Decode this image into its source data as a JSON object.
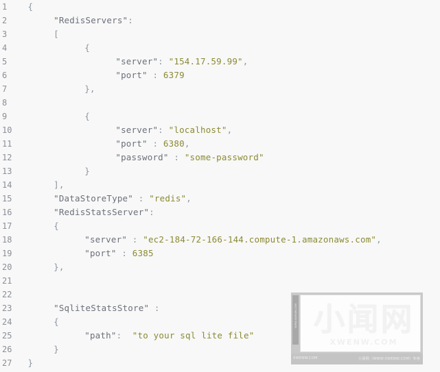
{
  "editor": {
    "language": "json",
    "background_color": "#f8f8f8",
    "gutter_color": "#8a8f98",
    "key_color": "#6b7079",
    "string_color": "#8a8a34",
    "punct_color": "#8d95a0",
    "total_lines": 27,
    "lines": [
      {
        "number": "1",
        "indent": 1,
        "tokens": [
          {
            "t": "{",
            "c": "punct"
          }
        ]
      },
      {
        "number": "2",
        "indent": 6,
        "tokens": [
          {
            "t": "\"RedisServers\"",
            "c": "key"
          },
          {
            "t": ":",
            "c": "punct"
          }
        ]
      },
      {
        "number": "3",
        "indent": 6,
        "tokens": [
          {
            "t": "[",
            "c": "punct"
          }
        ]
      },
      {
        "number": "4",
        "indent": 12,
        "tokens": [
          {
            "t": "{",
            "c": "punct"
          }
        ]
      },
      {
        "number": "5",
        "indent": 18,
        "tokens": [
          {
            "t": "\"server\"",
            "c": "key"
          },
          {
            "t": ": ",
            "c": "punct"
          },
          {
            "t": "\"154.17.59.99\"",
            "c": "str"
          },
          {
            "t": ",",
            "c": "punct"
          }
        ]
      },
      {
        "number": "6",
        "indent": 18,
        "tokens": [
          {
            "t": "\"port\"",
            "c": "key"
          },
          {
            "t": " : ",
            "c": "punct"
          },
          {
            "t": "6379",
            "c": "num"
          }
        ]
      },
      {
        "number": "7",
        "indent": 12,
        "tokens": [
          {
            "t": "}",
            "c": "punct"
          },
          {
            "t": ",",
            "c": "punct"
          }
        ]
      },
      {
        "number": "8",
        "indent": 0,
        "tokens": []
      },
      {
        "number": "9",
        "indent": 12,
        "tokens": [
          {
            "t": "{",
            "c": "punct"
          }
        ]
      },
      {
        "number": "10",
        "indent": 18,
        "tokens": [
          {
            "t": "\"server\"",
            "c": "key"
          },
          {
            "t": ": ",
            "c": "punct"
          },
          {
            "t": "\"localhost\"",
            "c": "str"
          },
          {
            "t": ",",
            "c": "punct"
          }
        ]
      },
      {
        "number": "11",
        "indent": 18,
        "tokens": [
          {
            "t": "\"port\"",
            "c": "key"
          },
          {
            "t": " : ",
            "c": "punct"
          },
          {
            "t": "6380",
            "c": "num"
          },
          {
            "t": ",",
            "c": "punct"
          }
        ]
      },
      {
        "number": "12",
        "indent": 18,
        "tokens": [
          {
            "t": "\"password\"",
            "c": "key"
          },
          {
            "t": " : ",
            "c": "punct"
          },
          {
            "t": "\"some-password\"",
            "c": "str"
          }
        ]
      },
      {
        "number": "13",
        "indent": 12,
        "tokens": [
          {
            "t": "}",
            "c": "punct"
          }
        ]
      },
      {
        "number": "14",
        "indent": 6,
        "tokens": [
          {
            "t": "]",
            "c": "punct"
          },
          {
            "t": ",",
            "c": "punct"
          }
        ]
      },
      {
        "number": "15",
        "indent": 6,
        "tokens": [
          {
            "t": "\"DataStoreType\"",
            "c": "key"
          },
          {
            "t": " : ",
            "c": "punct"
          },
          {
            "t": "\"redis\"",
            "c": "str"
          },
          {
            "t": ",",
            "c": "punct"
          }
        ]
      },
      {
        "number": "16",
        "indent": 6,
        "tokens": [
          {
            "t": "\"RedisStatsServer\"",
            "c": "key"
          },
          {
            "t": ":",
            "c": "punct"
          }
        ]
      },
      {
        "number": "17",
        "indent": 6,
        "tokens": [
          {
            "t": "{",
            "c": "punct"
          }
        ]
      },
      {
        "number": "18",
        "indent": 12,
        "tokens": [
          {
            "t": "\"server\"",
            "c": "key"
          },
          {
            "t": " : ",
            "c": "punct"
          },
          {
            "t": "\"ec2-184-72-166-144.compute-1.amazonaws.com\"",
            "c": "str"
          },
          {
            "t": ",",
            "c": "punct"
          }
        ]
      },
      {
        "number": "19",
        "indent": 12,
        "tokens": [
          {
            "t": "\"port\"",
            "c": "key"
          },
          {
            "t": " : ",
            "c": "punct"
          },
          {
            "t": "6385",
            "c": "num"
          }
        ]
      },
      {
        "number": "20",
        "indent": 6,
        "tokens": [
          {
            "t": "}",
            "c": "punct"
          },
          {
            "t": ",",
            "c": "punct"
          }
        ]
      },
      {
        "number": "21",
        "indent": 0,
        "tokens": []
      },
      {
        "number": "22",
        "indent": 0,
        "tokens": []
      },
      {
        "number": "23",
        "indent": 6,
        "tokens": [
          {
            "t": "\"SqliteStatsStore\"",
            "c": "key"
          },
          {
            "t": " :",
            "c": "punct"
          }
        ]
      },
      {
        "number": "24",
        "indent": 6,
        "tokens": [
          {
            "t": "{",
            "c": "punct"
          }
        ]
      },
      {
        "number": "25",
        "indent": 12,
        "tokens": [
          {
            "t": "\"path\"",
            "c": "key"
          },
          {
            "t": ":  ",
            "c": "punct"
          },
          {
            "t": "\"to your sql lite file\"",
            "c": "str"
          }
        ]
      },
      {
        "number": "26",
        "indent": 6,
        "tokens": [
          {
            "t": "}",
            "c": "punct"
          }
        ]
      },
      {
        "number": "27",
        "indent": 1,
        "tokens": [
          {
            "t": "}",
            "c": "punct"
          }
        ]
      }
    ]
  },
  "watermark": {
    "logo_text": "小闻网",
    "domain_text": "XWENW.COM",
    "sidebar_text": "WWW.XWENW.COM",
    "footer_left": "XWENW.COM",
    "footer_right": "小易网（WWW.XWENW.COM）专用"
  }
}
